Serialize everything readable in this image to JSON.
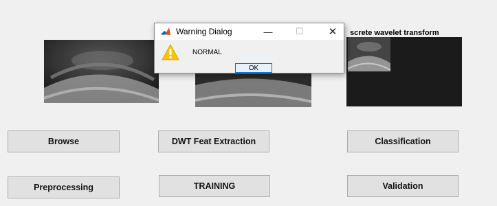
{
  "panels": {
    "right_title": "screte wavelet transform"
  },
  "buttons": {
    "browse": "Browse",
    "dwt": "DWT Feat Extraction",
    "classification": "Classification",
    "preprocessing": "Preprocessing",
    "training": "TRAINING",
    "validation": "Validation"
  },
  "dialog": {
    "title": "Warning Dialog",
    "message": "NORMAL",
    "ok_label": "OK",
    "minimize_glyph": "—",
    "maximize_glyph": "☐",
    "close_glyph": "✕"
  },
  "icons": {
    "app": "matlab-logo-icon",
    "warning": "warning-triangle-icon"
  },
  "colors": {
    "warning_yellow": "#f7c600",
    "ok_border": "#0078d7",
    "window_bg": "#f0f0f0"
  }
}
